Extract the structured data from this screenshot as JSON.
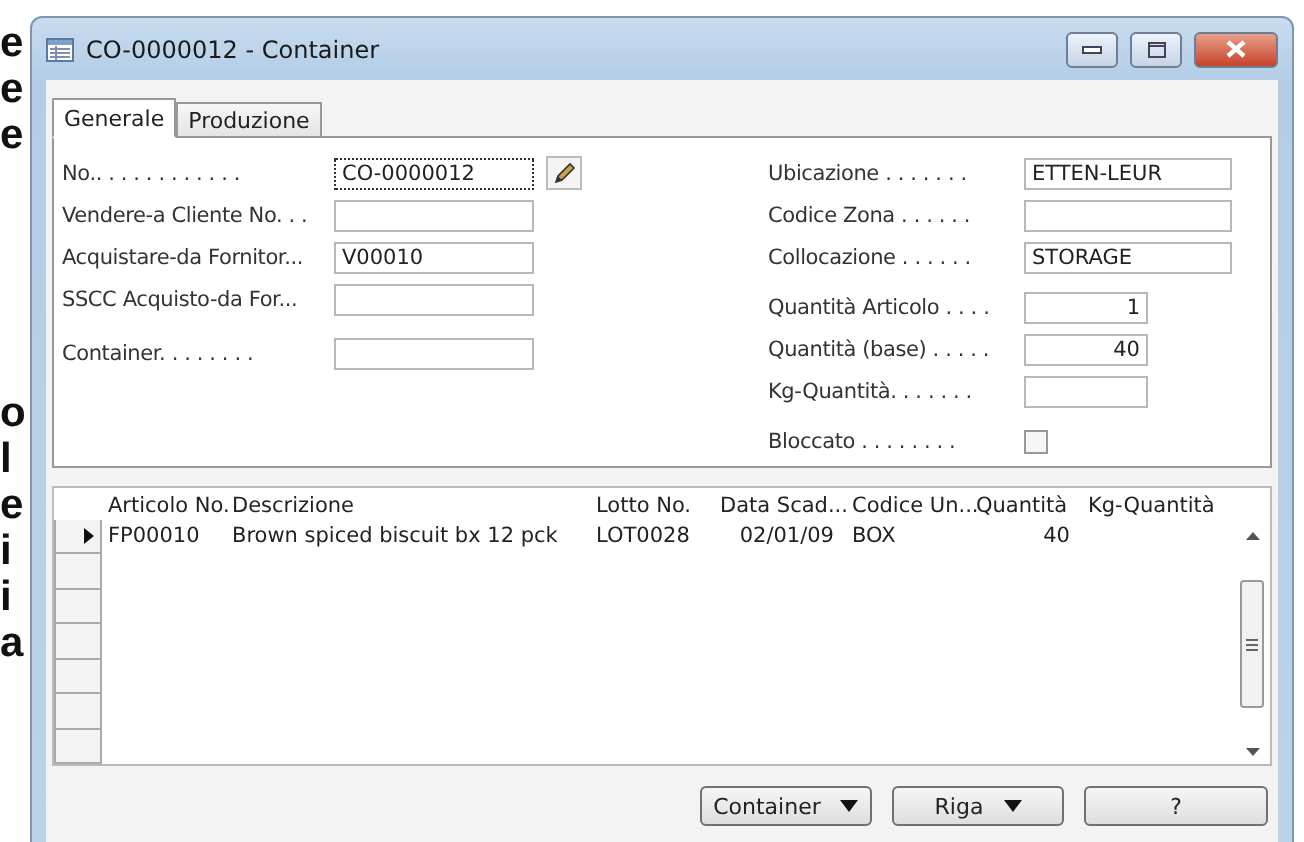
{
  "background_text_top": [
    "e",
    "e",
    "e"
  ],
  "background_text_bottom": [
    "o",
    "l",
    "e",
    "i",
    "i",
    "a"
  ],
  "window": {
    "title": "CO-0000012 - Container"
  },
  "tabs": [
    {
      "label": "Generale",
      "selected": true
    },
    {
      "label": "Produzione",
      "selected": false
    }
  ],
  "left_fields": [
    {
      "label": "No.. . . . . . . . . . . .",
      "value": "CO-0000012",
      "focused": true,
      "edit_button": true
    },
    {
      "label": "Vendere-a Cliente No. . .",
      "focused": false
    },
    {
      "label": "Acquistare-da Fornitor...",
      "value": "V00010",
      "focused": false
    },
    {
      "label": "SSCC Acquisto-da For...",
      "focused": false
    },
    {
      "label": "Container. . . . . . . .",
      "focused": false
    }
  ],
  "right_fields": [
    {
      "kind": "text",
      "label": "Ubicazione . . . . . . .",
      "value": "ETTEN-LEUR"
    },
    {
      "kind": "text",
      "label": "Codice Zona . . . . . ."
    },
    {
      "kind": "text",
      "label": "Collocazione . . . . . .",
      "value": "STORAGE"
    },
    {
      "kind": "number",
      "label": "Quantità Articolo . . . .",
      "value": "1"
    },
    {
      "kind": "number",
      "label": "Quantità (base) . . . . .",
      "value": "40"
    },
    {
      "kind": "number",
      "label": "Kg-Quantità. . . . . . ."
    },
    {
      "kind": "checkbox",
      "label": "Bloccato . . . . . . . .",
      "checked": false
    }
  ],
  "grid": {
    "columns": [
      "Articolo No.",
      "Descrizione",
      "Lotto No.",
      "Data Scad...",
      "Codice Un...",
      "Quantità",
      "Kg-Quantità"
    ],
    "rows": [
      {
        "current": true,
        "cells": [
          "FP00010",
          "Brown spiced biscuit bx 12 pck",
          "LOT0028",
          "02/01/09",
          "BOX",
          "40",
          ""
        ]
      }
    ]
  },
  "buttons": [
    {
      "label": "Container",
      "dropdown": true
    },
    {
      "label": "Riga",
      "dropdown": true
    },
    {
      "label": "?",
      "dropdown": false
    }
  ]
}
